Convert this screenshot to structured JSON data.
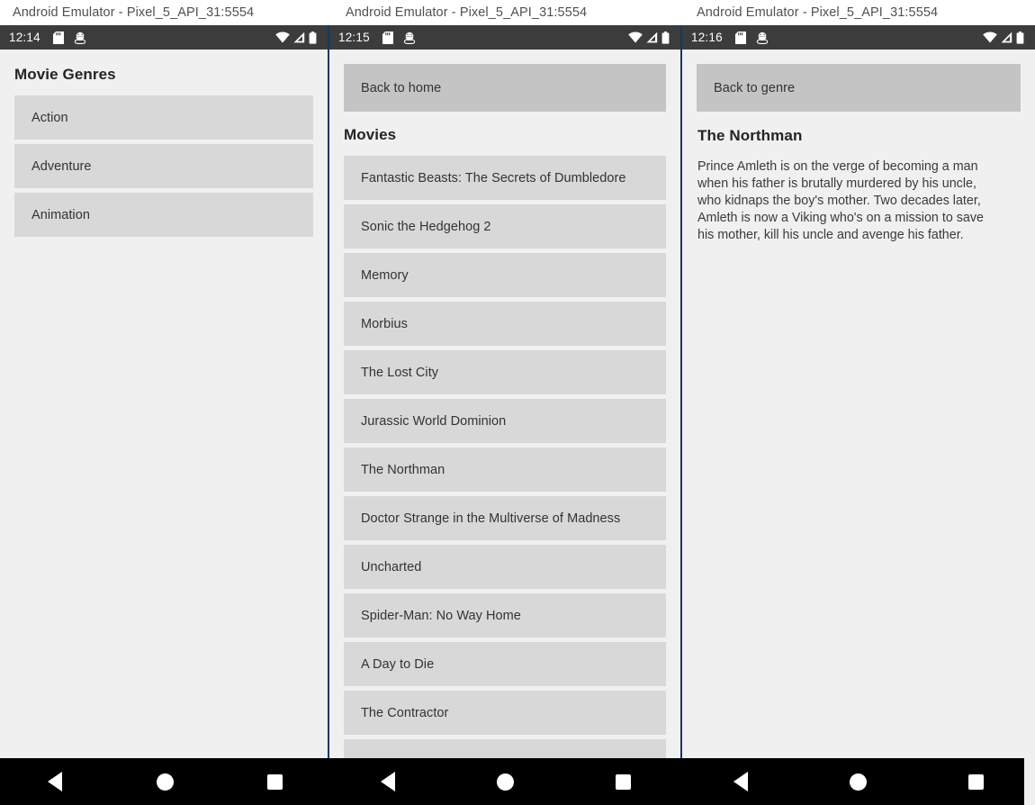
{
  "windows": [
    {
      "title": "Android Emulator - Pixel_5_API_31:5554",
      "status": {
        "time": "12:14",
        "icons_left": [
          "sd-card-icon",
          "android-debug-icon"
        ],
        "icons_right": [
          "wifi-icon",
          "cellular-signal-icon",
          "battery-icon"
        ]
      }
    },
    {
      "title": "Android Emulator - Pixel_5_API_31:5554",
      "status": {
        "time": "12:15",
        "icons_left": [
          "sd-card-icon",
          "android-debug-icon"
        ],
        "icons_right": [
          "wifi-icon",
          "cellular-signal-icon",
          "battery-icon"
        ]
      }
    },
    {
      "title": "Android Emulator - Pixel_5_API_31:5554",
      "status": {
        "time": "12:16",
        "icons_left": [
          "sd-card-icon",
          "android-debug-icon"
        ],
        "icons_right": [
          "wifi-icon",
          "cellular-signal-icon",
          "battery-icon"
        ]
      }
    }
  ],
  "genre_screen": {
    "title": "Movie Genres",
    "genres": [
      "Action",
      "Adventure",
      "Animation"
    ]
  },
  "movies_screen": {
    "back_button": "Back to home",
    "section_title": "Movies",
    "movies": [
      "Fantastic Beasts: The Secrets of Dumbledore",
      "Sonic the Hedgehog 2",
      "Memory",
      "Morbius",
      "The Lost City",
      "Jurassic World Dominion",
      "The Northman",
      "Doctor Strange in the Multiverse of Madness",
      "Uncharted",
      "Spider-Man: No Way Home",
      "A Day to Die",
      "The Contractor",
      ""
    ]
  },
  "detail_screen": {
    "back_button": "Back to genre",
    "movie_title": "The Northman",
    "overview": "Prince Amleth is on the verge of becoming a man when his father is brutally murdered by his uncle, who kidnaps the boy's mother. Two decades later, Amleth is now a Viking who's on a mission to save his mother, kill his uncle and avenge his father."
  },
  "navbar": {
    "back": "back-button",
    "home": "home-button",
    "recents": "recents-button"
  },
  "colors": {
    "app_background": "#f0f0f0",
    "list_item": "#d8d8d8",
    "flat_button": "#c4c4c4",
    "status_bar": "#3c3c3c",
    "separator": "#123a5e",
    "nav_bar": "#000000",
    "title_text": "#4d5156"
  }
}
